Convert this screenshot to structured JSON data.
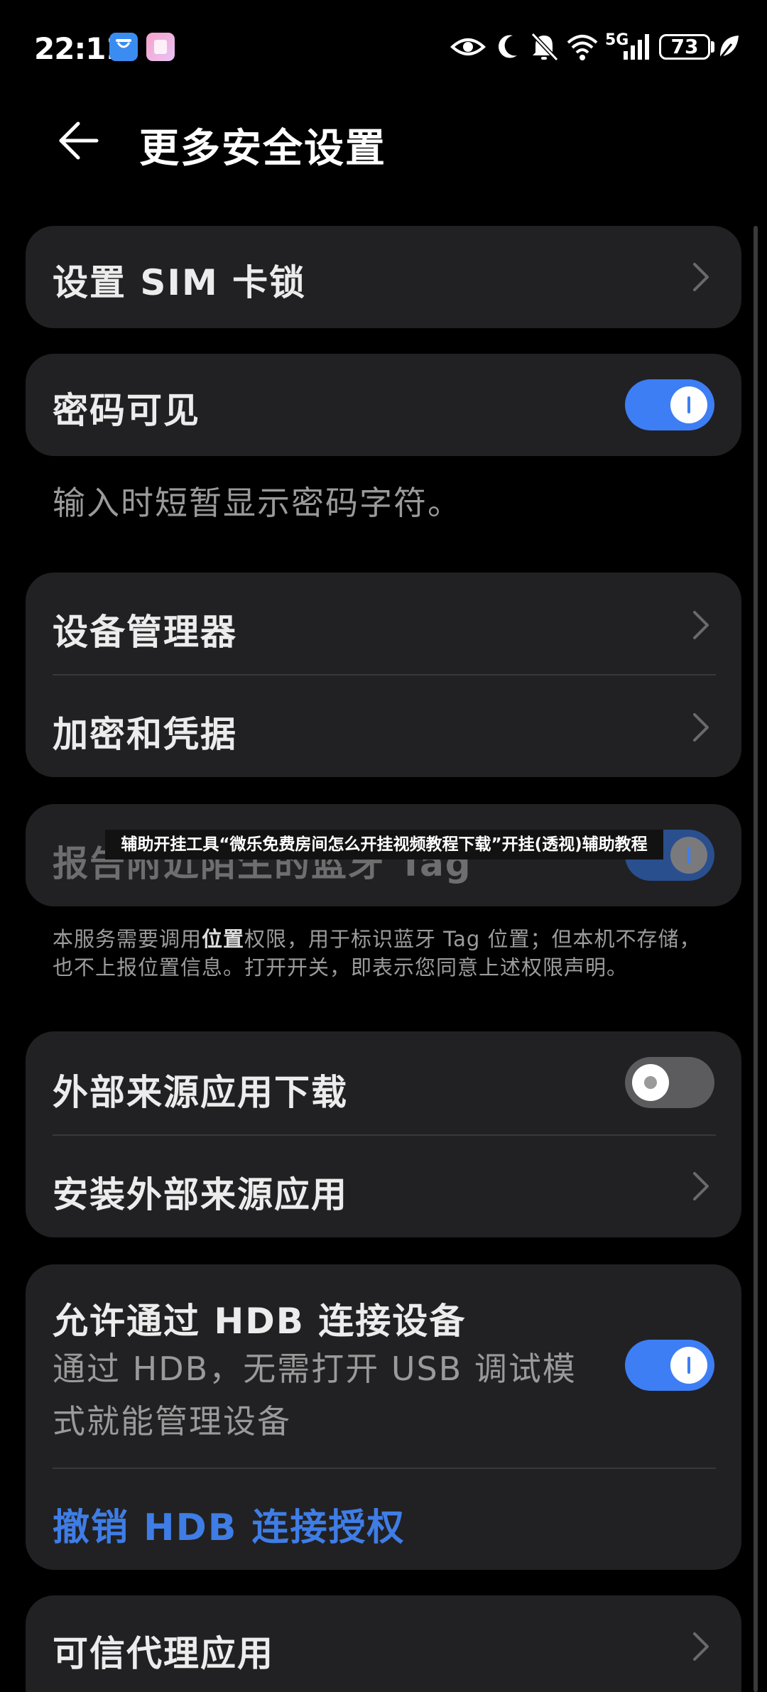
{
  "status_bar": {
    "time": "22:11",
    "network": "5G",
    "battery": "73"
  },
  "header": {
    "title": "更多安全设置"
  },
  "settings": {
    "sim_lock": "设置 SIM 卡锁",
    "password_visible": {
      "label": "密码可见",
      "enabled": true,
      "hint": "输入时短暂显示密码字符。"
    },
    "device_admin": "设备管理器",
    "credentials": "加密和凭据",
    "tag_report": {
      "label": "报告附近陌生的蓝牙 Tag",
      "enabled": true,
      "note_pre": "本服务需要调用",
      "note_bold": "位置",
      "note_post": "权限，用于标识蓝牙 Tag 位置；但本机不存储，也不上报位置信息。打开开关，即表示您同意上述权限声明。"
    },
    "external_download": {
      "label": "外部来源应用下载",
      "enabled": false
    },
    "install_external": "安装外部来源应用",
    "hdb": {
      "label": "允许通过 HDB 连接设备",
      "sub": "通过 HDB，无需打开 USB 调试模式就能管理设备",
      "enabled": true,
      "revoke": "撤销 HDB 连接授权"
    },
    "trust_agents": "可信代理应用"
  },
  "overlay_banner": "辅助开挂工具“微乐免费房间怎么开挂视频教程下载”开挂(透视)辅助教程",
  "colors": {
    "accent": "#3d7ef5",
    "card": "#212123",
    "link": "#3f7de6"
  }
}
